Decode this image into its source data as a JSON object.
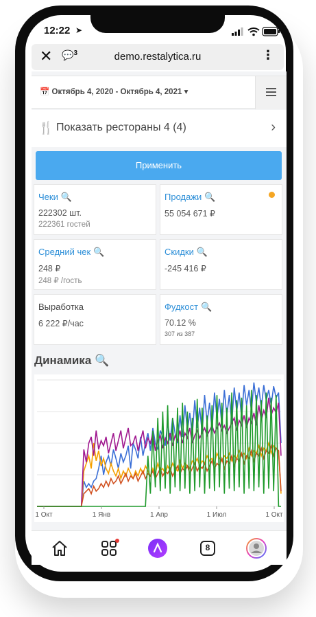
{
  "status_bar": {
    "time": "12:22",
    "location_icon": "location-arrow-icon"
  },
  "browser": {
    "url": "demo.restalytica.ru",
    "comments_count": "3"
  },
  "filters": {
    "date_range": "Октябрь 4, 2020 - Октябрь 4, 2021"
  },
  "restaurants": {
    "label": "Показать рестораны 4 (4)"
  },
  "apply_button": "Применить",
  "cards": {
    "checks": {
      "title": "Чеки",
      "line1": "222302 шт.",
      "line2": "222361  гостей"
    },
    "sales": {
      "title": "Продажи",
      "line1": "55 054 671 ₽",
      "dot_color": "#f5a623"
    },
    "avg_check": {
      "title": "Средний чек",
      "line1": "248 ₽",
      "line2": "248 ₽ /гость"
    },
    "discounts": {
      "title": "Скидки",
      "line1": "-245 416 ₽"
    },
    "output": {
      "title": "Выработка",
      "line1": "6 222 ₽/час"
    },
    "foodcost": {
      "title": "Фудкост",
      "line1": "70.12 %",
      "line2": "307 из 387"
    }
  },
  "dynamics": {
    "title": "Динамика"
  },
  "chart_data": {
    "type": "line",
    "x_ticks": [
      "1 Окт",
      "1 Янв",
      "1 Апр",
      "1 Июл",
      "1 Окт"
    ],
    "grid": true,
    "series": [
      {
        "color": "#3b6fd6",
        "values": [
          0,
          0,
          0,
          0,
          0,
          0,
          0,
          0,
          0,
          0,
          0,
          0,
          0,
          0,
          0,
          0,
          0,
          0,
          0,
          20,
          15,
          18,
          15,
          20,
          22,
          30,
          40,
          25,
          35,
          40,
          32,
          45,
          38,
          30,
          42,
          35,
          40,
          48,
          30,
          50,
          45,
          38,
          55,
          40,
          50,
          58,
          44,
          62,
          50,
          45,
          60,
          55,
          48,
          66,
          52,
          70,
          58,
          50,
          72,
          55,
          80,
          60,
          74,
          56,
          84,
          62,
          78,
          58,
          88,
          66,
          82,
          60,
          90,
          70,
          85,
          64,
          92,
          72,
          88,
          66,
          94,
          75,
          90,
          70,
          96,
          80,
          92,
          75,
          98,
          82,
          94,
          78,
          96,
          84,
          92,
          80,
          95,
          86,
          90,
          50
        ]
      },
      {
        "color": "#f5a000",
        "values": [
          0,
          0,
          0,
          0,
          0,
          0,
          0,
          0,
          0,
          0,
          0,
          0,
          0,
          0,
          0,
          0,
          0,
          0,
          0,
          28,
          34,
          40,
          30,
          50,
          36,
          44,
          32,
          38,
          30,
          26,
          34,
          28,
          24,
          30,
          22,
          28,
          24,
          30,
          26,
          22,
          28,
          24,
          30,
          26,
          32,
          28,
          24,
          30,
          26,
          34,
          28,
          30,
          26,
          32,
          28,
          34,
          30,
          28,
          36,
          30,
          34,
          32,
          30,
          36,
          34,
          38,
          32,
          36,
          34,
          40,
          36,
          38,
          34,
          42,
          38,
          36,
          40,
          38,
          42,
          36,
          40,
          38,
          44,
          40,
          42,
          38,
          46,
          40,
          44,
          42,
          48,
          40,
          46,
          44,
          50,
          42,
          48,
          46,
          44,
          10
        ]
      },
      {
        "color": "#a0188f",
        "values": [
          0,
          0,
          0,
          0,
          0,
          0,
          0,
          0,
          0,
          0,
          0,
          0,
          0,
          0,
          0,
          0,
          0,
          0,
          0,
          45,
          35,
          50,
          55,
          40,
          60,
          45,
          52,
          48,
          55,
          42,
          50,
          58,
          44,
          52,
          60,
          46,
          54,
          62,
          48,
          50,
          56,
          44,
          52,
          60,
          46,
          54,
          50,
          58,
          44,
          52,
          56,
          46,
          54,
          50,
          58,
          48,
          56,
          52,
          60,
          50,
          58,
          54,
          62,
          50,
          56,
          60,
          54,
          58,
          62,
          56,
          60,
          64,
          58,
          62,
          66,
          60,
          64,
          58,
          62,
          66,
          70,
          60,
          68,
          64,
          72,
          62,
          70,
          66,
          74,
          64,
          80,
          68,
          76,
          70,
          86,
          72,
          78,
          74,
          82,
          40
        ]
      },
      {
        "color": "#d0501f",
        "values": [
          0,
          0,
          0,
          0,
          0,
          0,
          0,
          0,
          0,
          0,
          0,
          0,
          0,
          0,
          0,
          0,
          0,
          0,
          0,
          10,
          12,
          14,
          10,
          16,
          12,
          14,
          18,
          15,
          20,
          16,
          22,
          18,
          20,
          24,
          18,
          22,
          26,
          20,
          24,
          22,
          26,
          20,
          24,
          28,
          22,
          26,
          24,
          28,
          22,
          26,
          30,
          24,
          28,
          26,
          30,
          24,
          28,
          32,
          26,
          30,
          28,
          32,
          26,
          30,
          34,
          28,
          32,
          30,
          34,
          28,
          32,
          36,
          30,
          34,
          32,
          38,
          30,
          36,
          34,
          40,
          32,
          38,
          36,
          42,
          34,
          40,
          38,
          44,
          36,
          42,
          40,
          46,
          38,
          44,
          42,
          48,
          40,
          46,
          44,
          12
        ]
      },
      {
        "color": "#1f9a2c",
        "values": [
          0,
          0,
          0,
          0,
          0,
          0,
          0,
          0,
          0,
          0,
          0,
          0,
          0,
          0,
          0,
          0,
          0,
          0,
          0,
          0,
          0,
          0,
          0,
          0,
          0,
          0,
          0,
          0,
          0,
          0,
          0,
          0,
          0,
          0,
          0,
          0,
          0,
          0,
          0,
          0,
          0,
          0,
          0,
          0,
          0,
          40,
          10,
          60,
          15,
          70,
          12,
          75,
          14,
          80,
          10,
          70,
          15,
          78,
          12,
          82,
          14,
          75,
          10,
          70,
          12,
          85,
          15,
          78,
          10,
          72,
          14,
          80,
          12,
          88,
          15,
          82,
          10,
          78,
          14,
          90,
          12,
          84,
          15,
          86,
          10,
          80,
          14,
          92,
          12,
          88,
          15,
          84,
          10,
          90,
          14,
          86,
          12,
          88,
          0,
          0
        ]
      }
    ]
  },
  "bottom_nav": {
    "home": "home-icon",
    "services": "services-grid-icon",
    "assistant": "alice-assistant-icon",
    "tabs_count": "8",
    "profile": "avatar"
  }
}
